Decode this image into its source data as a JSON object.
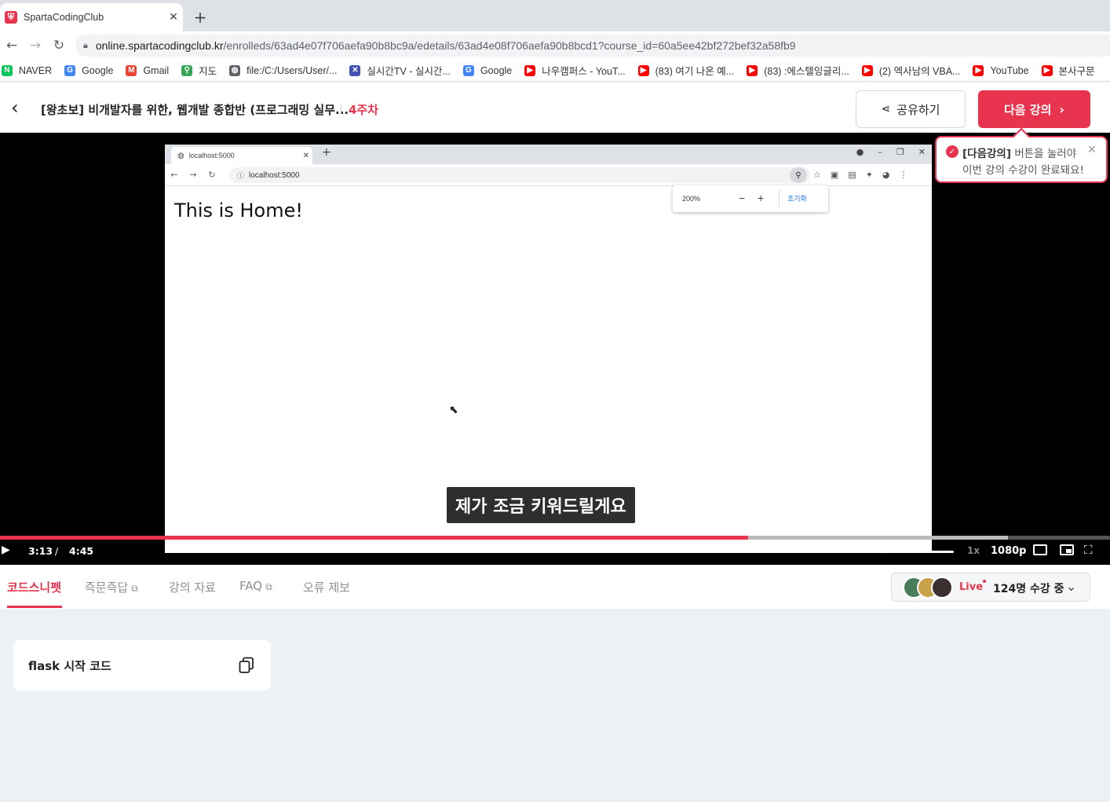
{
  "browser": {
    "tab_title": "SpartaCodingClub",
    "url_host": "online.spartacodingclub.kr",
    "url_path": "/enrolleds/63ad4e07f706aefa90b8bc9a/edetails/63ad4e08f706aefa90b8bcd1?course_id=60a5ee42bf272bef32a58fb9",
    "bookmarks": [
      {
        "label": "NAVER",
        "icon": "naver-icon",
        "color": "#03c75a"
      },
      {
        "label": "Google",
        "icon": "google-icon",
        "color": "#4285f4"
      },
      {
        "label": "Gmail",
        "icon": "gmail-icon",
        "color": "#ea4335"
      },
      {
        "label": "지도",
        "icon": "maps-icon",
        "color": "#34a853"
      },
      {
        "label": "file:/C:/Users/User/...",
        "icon": "globe-icon",
        "color": "#5f6368"
      },
      {
        "label": "실시간TV - 실시간...",
        "icon": "tv-icon",
        "color": "#3f51b5"
      },
      {
        "label": "Google",
        "icon": "google-icon",
        "color": "#4285f4"
      },
      {
        "label": "나우캠퍼스 - YouT...",
        "icon": "youtube-icon",
        "color": "#ff0000"
      },
      {
        "label": "(83) 여기 나온 예...",
        "icon": "youtube-icon",
        "color": "#ff0000"
      },
      {
        "label": "(83) :에스텔잉글리...",
        "icon": "youtube-icon",
        "color": "#ff0000"
      },
      {
        "label": "(2) 엑사남의 VBA...",
        "icon": "youtube-icon",
        "color": "#ff0000"
      },
      {
        "label": "YouTube",
        "icon": "youtube-icon",
        "color": "#ff0000"
      },
      {
        "label": "본사구문",
        "icon": "youtube-icon",
        "color": "#ff0000"
      }
    ]
  },
  "header": {
    "course_title": "[왕초보] 비개발자를 위한, 웹개발 종합반 (프로그래밍 실무...",
    "week": "4주차",
    "share_label": "공유하기",
    "next_label": "다음 강의"
  },
  "tooltip": {
    "highlight": "[다음강의]",
    "line1_rest": " 버튼을 눌러야",
    "line2": "이번 강의 수강이 완료돼요!"
  },
  "video": {
    "inner_tab_title": "localhost:5000",
    "inner_url": "localhost:5000",
    "zoom_level": "200%",
    "zoom_reset": "초기화",
    "page_text": "This is Home!",
    "caption": "제가 조금 키워드릴게요",
    "current_time": "3:13",
    "time_separator": "/",
    "total_time": "4:45",
    "played_fraction": 0.674,
    "buffered_fraction": 0.908,
    "volume_fraction": 1.0,
    "speed": "1x",
    "quality": "1080p"
  },
  "lecture_tabs": [
    {
      "label": "코드스니펫",
      "active": true
    },
    {
      "label": "즉문즉답",
      "external": true
    },
    {
      "label": "강의 자료"
    },
    {
      "label": "FAQ",
      "external": true
    },
    {
      "label": "오류 제보"
    }
  ],
  "live": {
    "label": "Live",
    "viewers": "124명 수강 중"
  },
  "snippet": {
    "title": "flask 시작 코드"
  },
  "colors": {
    "accent": "#e8344e"
  }
}
